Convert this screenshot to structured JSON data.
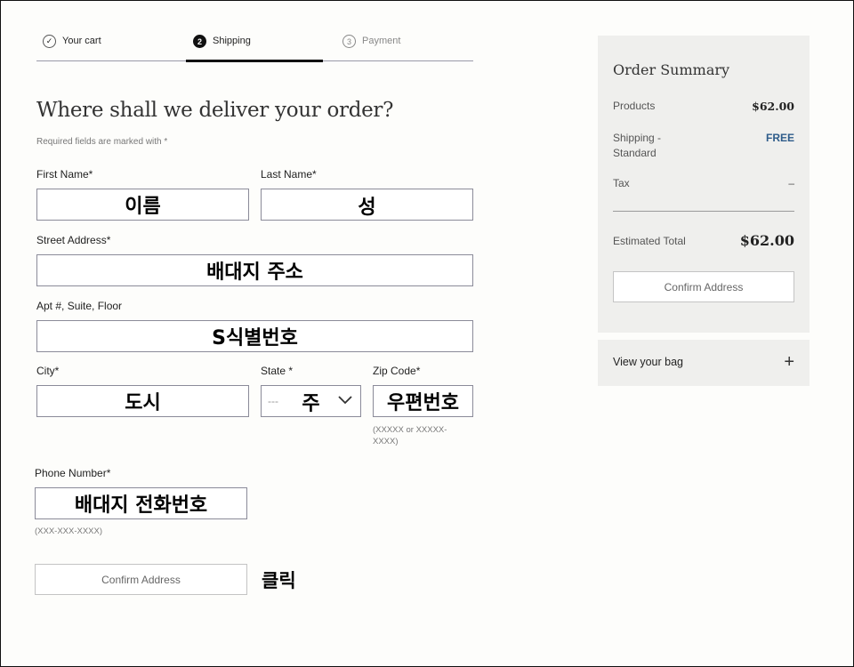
{
  "steps": [
    {
      "num": "✓",
      "label": "Your cart"
    },
    {
      "num": "2",
      "label": "Shipping"
    },
    {
      "num": "3",
      "label": "Payment"
    }
  ],
  "heading": "Where shall we deliver your order?",
  "required_note": "Required fields are marked with *",
  "form": {
    "first_name": {
      "label": "First Name*",
      "value": "이름"
    },
    "last_name": {
      "label": "Last Name*",
      "value": "성"
    },
    "street": {
      "label": "Street Address*",
      "value": "배대지 주소"
    },
    "apt": {
      "label": "Apt #, Suite, Floor",
      "value": "S식별번호"
    },
    "city": {
      "label": "City*",
      "value": "도시"
    },
    "state": {
      "label": "State *",
      "placeholder": "---",
      "value": "주"
    },
    "zip": {
      "label": "Zip Code*",
      "value": "우편번호",
      "hint": "(XXXXX or XXXXX-XXXX)"
    },
    "phone": {
      "label": "Phone Number*",
      "value": "배대지 전화번호",
      "hint": "(XXX-XXX-XXXX)"
    },
    "confirm_button": "Confirm Address",
    "click_note": "클릭"
  },
  "summary": {
    "title": "Order Summary",
    "products_label": "Products",
    "products_value": "$62.00",
    "shipping_label_1": "Shipping -",
    "shipping_label_2": "Standard",
    "shipping_value": "FREE",
    "tax_label": "Tax",
    "tax_value": "–",
    "total_label": "Estimated Total",
    "total_value": "$62.00",
    "confirm_button": "Confirm Address"
  },
  "bag": {
    "label": "View your bag",
    "icon": "plus-icon"
  }
}
